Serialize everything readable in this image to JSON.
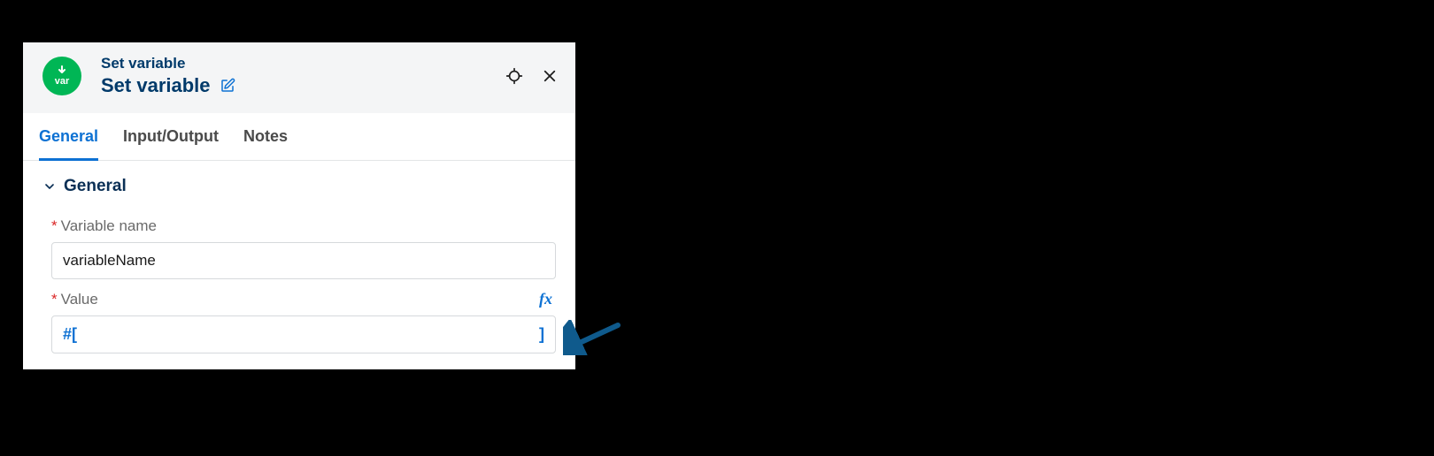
{
  "header": {
    "type_label": "Set variable",
    "title": "Set variable",
    "icon_label": "var"
  },
  "tabs": [
    {
      "label": "General",
      "active": true
    },
    {
      "label": "Input/Output",
      "active": false
    },
    {
      "label": "Notes",
      "active": false
    }
  ],
  "section": {
    "name": "General"
  },
  "fields": {
    "variable_name": {
      "label": "Variable name",
      "required": true,
      "value": "variableName"
    },
    "value": {
      "label": "Value",
      "required": true,
      "fx_label": "fx",
      "expr_open": "#[",
      "expr_close": "]",
      "expr_body": ""
    }
  },
  "marks": {
    "required": "*"
  }
}
